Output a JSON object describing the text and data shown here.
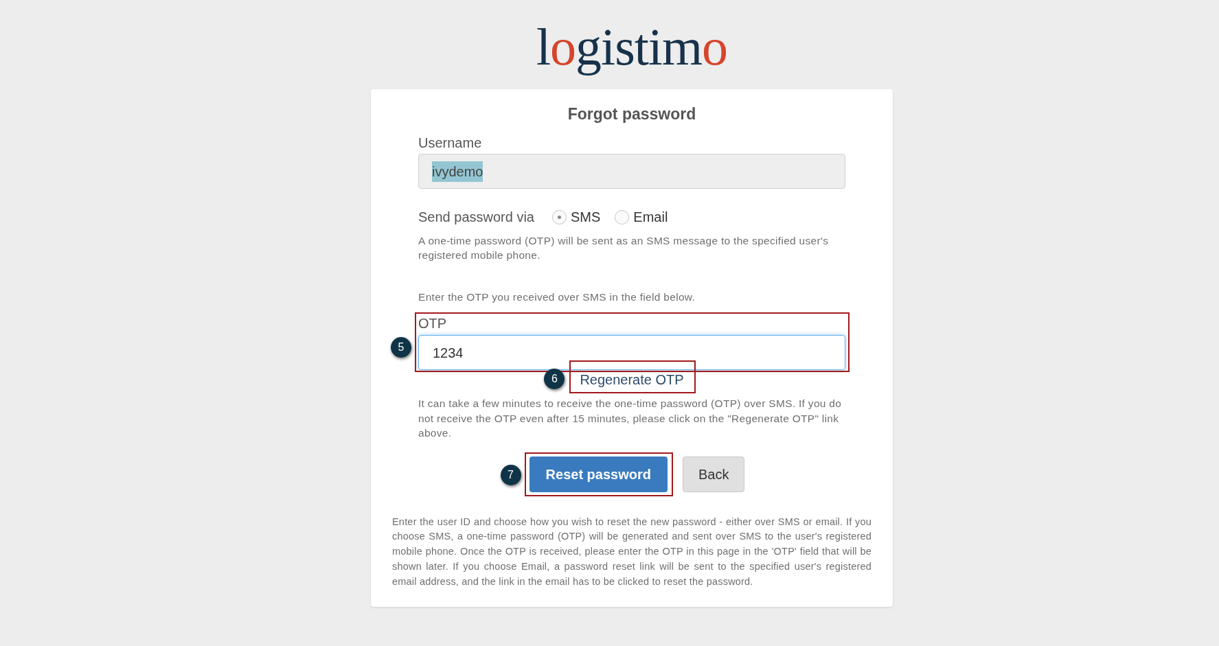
{
  "logo": {
    "parts": [
      {
        "text": "l",
        "accent": false
      },
      {
        "text": "o",
        "accent": true
      },
      {
        "text": "gistim",
        "accent": false
      },
      {
        "text": "o",
        "accent": true
      }
    ]
  },
  "form": {
    "title": "Forgot password",
    "username": {
      "label": "Username",
      "value": "ivydemo",
      "highlighted": true
    },
    "send_via": {
      "label": "Send password via",
      "options": [
        {
          "label": "SMS",
          "selected": true
        },
        {
          "label": "Email",
          "selected": false
        }
      ]
    },
    "send_note": "A one-time password (OTP) will be sent as an SMS message to the specified user's registered mobile phone.",
    "otp_instruction": "Enter the OTP you received over SMS in the field below.",
    "otp": {
      "label": "OTP",
      "value": "1234",
      "focused": true,
      "callout": "5"
    },
    "regenerate_link": {
      "label": "Regenerate OTP",
      "callout": "6"
    },
    "otp_note": "It can take a few minutes to receive the one-time password (OTP) over SMS. If you do not receive the OTP even after 15 minutes, please click on the \"Regenerate OTP\" link above.",
    "buttons": [
      {
        "label": "Reset password",
        "kind": "primary",
        "callout": "7"
      },
      {
        "label": "Back",
        "kind": "default"
      }
    ],
    "help_text": "Enter the user ID and choose how you wish to reset the new password - either over SMS or email. If you choose SMS, a one-time password (OTP) will be generated and sent over SMS to the user's registered mobile phone. Once the OTP is received, please enter the OTP in this page in the 'OTP' field that will be shown later. If you choose Email, a password reset link will be sent to the specified user's registered email address, and the link in the email has to be clicked to reset the password."
  }
}
